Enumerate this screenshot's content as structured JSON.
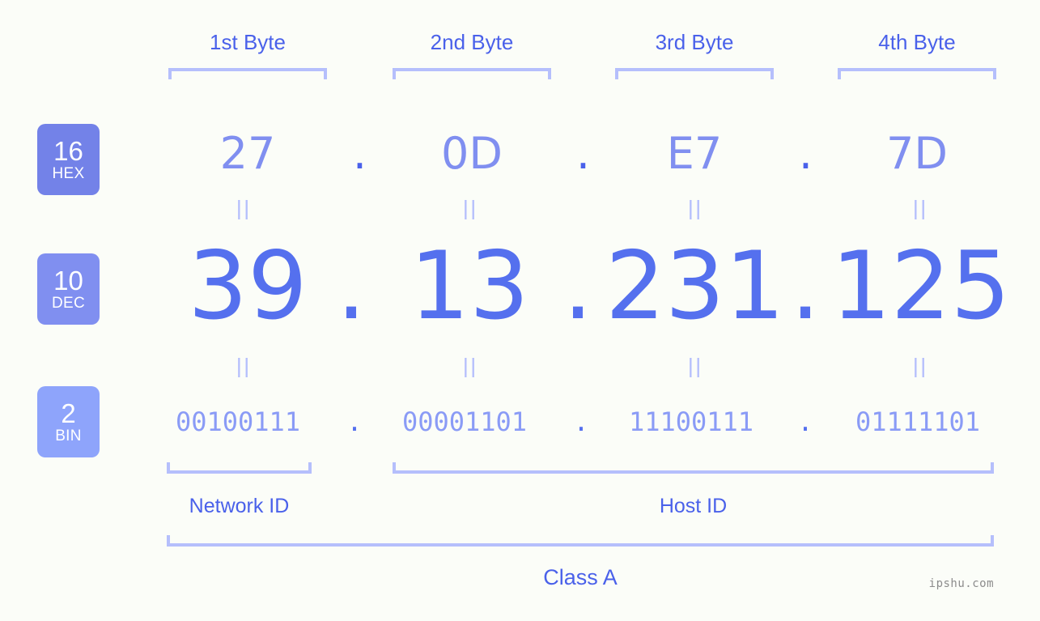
{
  "page": {
    "background_color": "#fbfdf8",
    "accent_color": "#5570ee",
    "bracket_color": "#b5bffc",
    "watermark": "ipshu.com"
  },
  "byte_headers": [
    {
      "label": "1st Byte"
    },
    {
      "label": "2nd Byte"
    },
    {
      "label": "3rd Byte"
    },
    {
      "label": "4th Byte"
    }
  ],
  "bases": [
    {
      "number": "16",
      "abbr": "HEX",
      "color": "#7382e8"
    },
    {
      "number": "10",
      "abbr": "DEC",
      "color": "#808ff0"
    },
    {
      "number": "2",
      "abbr": "BIN",
      "color": "#8ea4fb"
    }
  ],
  "rows": {
    "hex": {
      "values": [
        "27",
        "0D",
        "E7",
        "7D"
      ],
      "separator": "."
    },
    "dec": {
      "values": [
        "39",
        "13",
        "231",
        "125"
      ],
      "separator": "."
    },
    "bin": {
      "values": [
        "00100111",
        "00001101",
        "11100111",
        "01111101"
      ],
      "separator": "."
    }
  },
  "equals_marks": {
    "glyph": "||",
    "count_per_row": 4
  },
  "sections": [
    {
      "label": "Network ID"
    },
    {
      "label": "Host ID"
    }
  ],
  "class": {
    "label": "Class A"
  }
}
